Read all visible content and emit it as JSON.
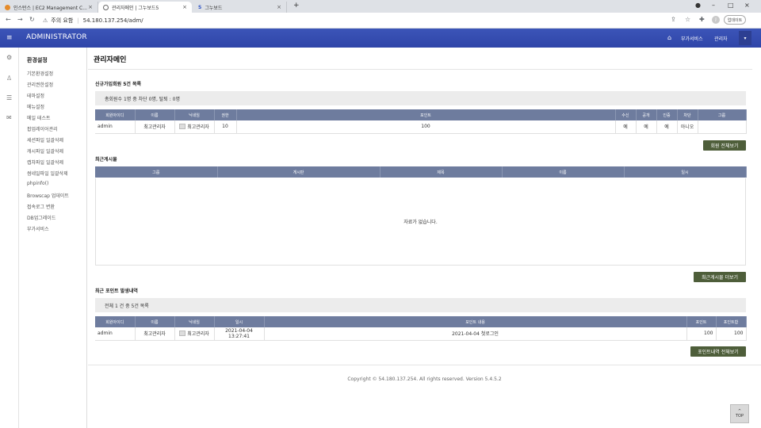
{
  "browser": {
    "tabs": [
      {
        "label": "인스턴스 | EC2 Management C...",
        "active": false
      },
      {
        "label": "관리자메인 | 그누보드5",
        "active": true
      },
      {
        "label": "그누보드",
        "active": false
      }
    ],
    "new_tab": "+",
    "security_warning": "주의 요함",
    "url": "54.180.137.254/adm/",
    "profile_initial": "J",
    "update_button": "업데이트"
  },
  "header": {
    "title": "ADMINISTRATOR",
    "services_label": "부가서비스",
    "user_label": "관리자"
  },
  "sidebar": {
    "heading": "환경설정",
    "items": [
      "기본환경설정",
      "관리권한설정",
      "테마설정",
      "메뉴설정",
      "메일 테스트",
      "팝업레이어관리",
      "세션파일 일괄삭제",
      "캐시파일 일괄삭제",
      "캡챠파일 일괄삭제",
      "썸네일파일 일괄삭제",
      "phpinfo()",
      "Browscap 업데이트",
      "접속로그 변환",
      "DB업그레이드",
      "부가서비스"
    ]
  },
  "main": {
    "page_title": "관리자메인",
    "new_members": {
      "title": "신규가입회원 5건 목록",
      "summary": "총회원수 1명 중 차단 0명, 탈퇴 : 0명",
      "columns": [
        "회원아이디",
        "이름",
        "닉네임",
        "권한",
        "포인트",
        "수신",
        "공개",
        "인증",
        "차단",
        "그룹"
      ],
      "rows": [
        [
          "admin",
          "최고관리자",
          "최고관리자",
          "10",
          "100",
          "예",
          "예",
          "예",
          "아니오",
          ""
        ]
      ],
      "button": "회원 전체보기"
    },
    "recent_posts": {
      "title": "최근게시물",
      "columns": [
        "그룹",
        "게시판",
        "제목",
        "이름",
        "일시"
      ],
      "empty": "자료가 없습니다.",
      "button": "최근게시물 더보기"
    },
    "points": {
      "title": "최근 포인트 발생내역",
      "summary": "전체 1 건 중 5건 목록",
      "columns": [
        "회원아이디",
        "이름",
        "닉네임",
        "일시",
        "포인트 내용",
        "포인트",
        "포인트합"
      ],
      "rows": [
        [
          "admin",
          "최고관리자",
          "최고관리자",
          "2021-04-04 13:27:41",
          "2021-04-04 첫로그인",
          "100",
          "100"
        ]
      ],
      "button": "포인트내역 전체보기"
    },
    "copyright": "Copyright © 54.180.137.254. All rights reserved. Version 5.4.5.2"
  },
  "top_button": "TOP",
  "colors": {
    "header_blue": "#3c55b8",
    "table_header": "#6e7c9e",
    "button_olive": "#4e5e3a"
  }
}
